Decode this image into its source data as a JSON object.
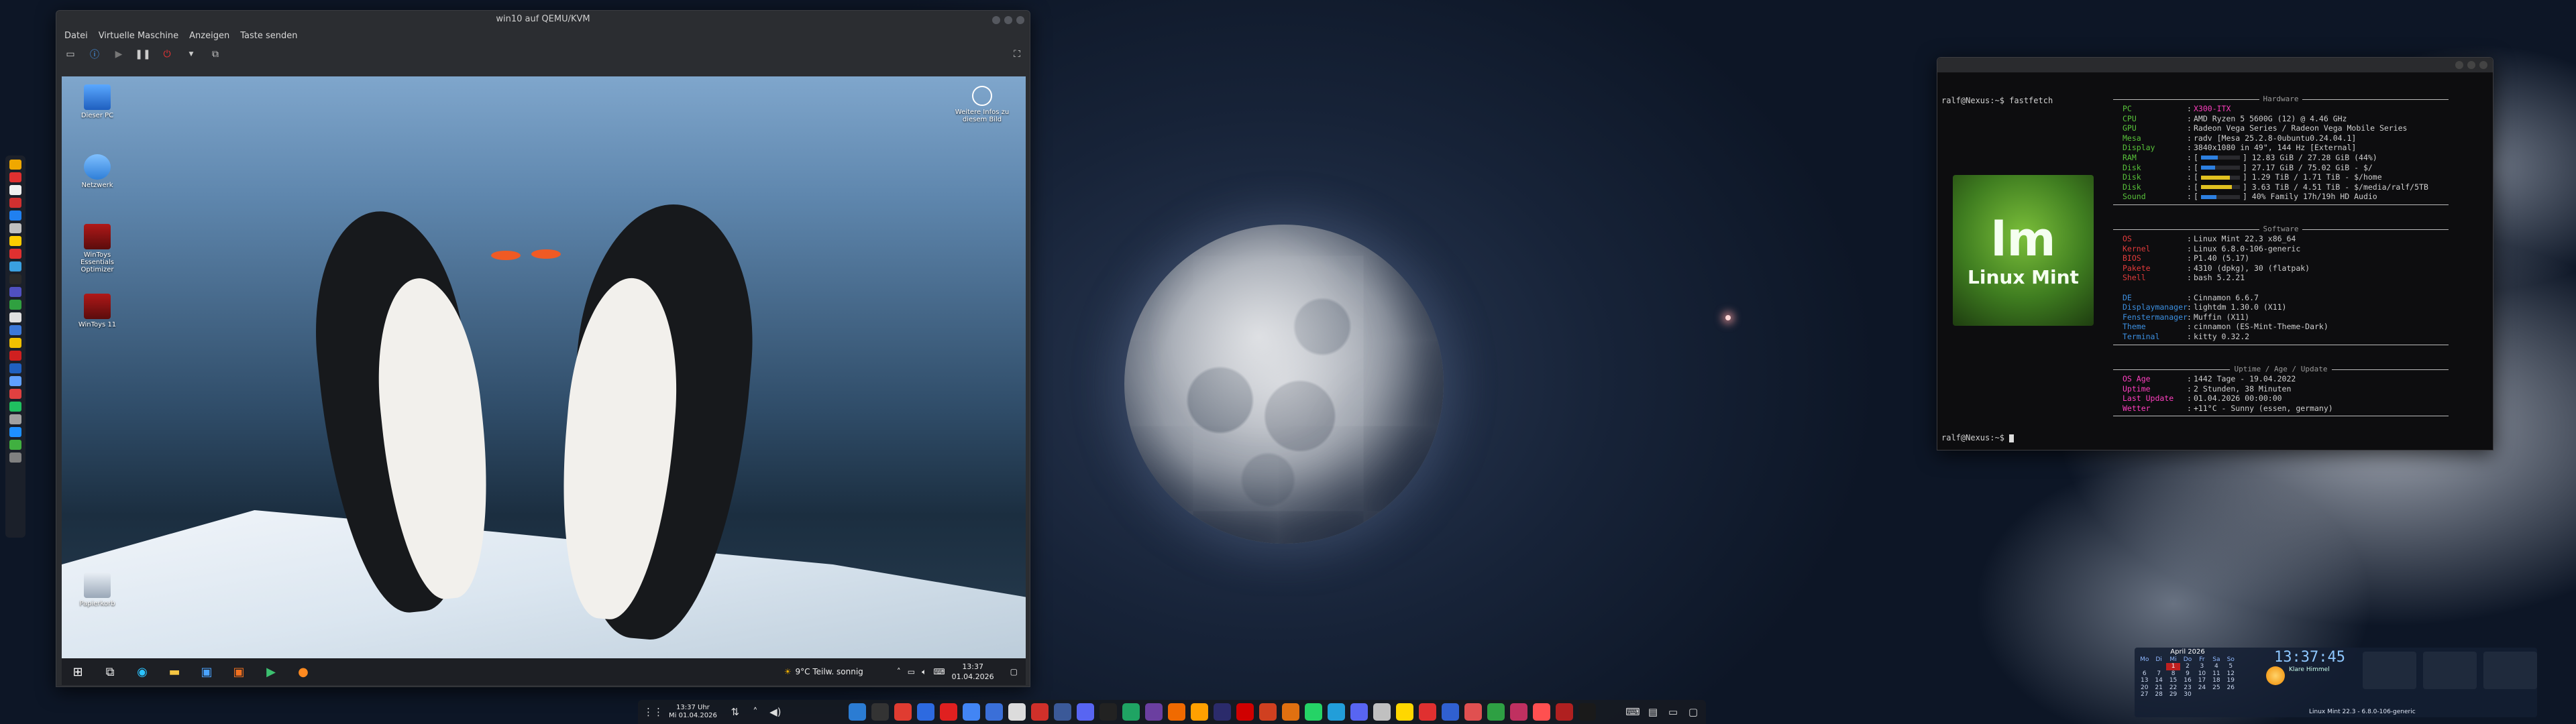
{
  "vm": {
    "title": "win10 auf QEMU/KVM",
    "menu": [
      "Datei",
      "Virtuelle Maschine",
      "Anzeigen",
      "Taste senden"
    ]
  },
  "guest": {
    "icons": [
      {
        "label": "Dieser PC"
      },
      {
        "label": "Netzwerk"
      },
      {
        "label": "WinToys Essentials Optimizer"
      },
      {
        "label": "WinToys 11"
      },
      {
        "label": "Papierkorb"
      }
    ],
    "info_label": "Weitere Infos zu diesem Bild",
    "weather": "9°C  Teilw. sonnig",
    "clock_time": "13:37",
    "clock_date": "01.04.2026"
  },
  "terminal": {
    "prompt": "ralf@Nexus:~$ fastfetch",
    "prompt_end": "ralf@Nexus:~$ ",
    "logo_text": "Linux Mint",
    "sections": [
      {
        "title": "Hardware",
        "rows": [
          {
            "key": "PC",
            "value": "X300-ITX",
            "color": "#58c23a",
            "value_color": "#ff3fbf"
          },
          {
            "key": "CPU",
            "value": "AMD Ryzen 5 5600G (12) @ 4.46 GHz",
            "color": "#58c23a"
          },
          {
            "key": "GPU",
            "value": "Radeon Vega Series / Radeon Vega Mobile Series",
            "color": "#58c23a"
          },
          {
            "key": "Mesa",
            "value": "radv [Mesa 25.2.8-0ubuntu0.24.04.1]",
            "color": "#58c23a"
          },
          {
            "key": "Display",
            "value": "3840x1080 in 49\", 144 Hz [External]",
            "color": "#58c23a"
          },
          {
            "key": "RAM",
            "value": "] 12.83 GiB / 27.28 GiB (44%)",
            "color": "#58c23a",
            "bar": 0.44,
            "bar_color": "#2d7fe0"
          },
          {
            "key": "Disk",
            "value": "] 27.17 GiB / 75.02 GiB - $/",
            "color": "#58c23a",
            "bar": 0.36,
            "bar_color": "#2d7fe0"
          },
          {
            "key": "Disk",
            "value": "] 1.29 TiB / 1.71 TiB - $/home",
            "color": "#58c23a",
            "bar": 0.75,
            "bar_color": "#e0c020"
          },
          {
            "key": "Disk",
            "value": "] 3.63 TiB / 4.51 TiB - $/media/ralf/5TB",
            "color": "#58c23a",
            "bar": 0.8,
            "bar_color": "#e0c020"
          },
          {
            "key": "Sound",
            "value": "] 40% Family 17h/19h HD Audio",
            "color": "#58c23a",
            "bar": 0.4,
            "bar_color": "#2d7fe0"
          }
        ]
      },
      {
        "title": "Software",
        "rows": [
          {
            "key": "OS",
            "value": "Linux Mint 22.3 x86_64",
            "color": "#e23b3b"
          },
          {
            "key": "Kernel",
            "value": "Linux 6.8.0-106-generic",
            "color": "#e23b3b"
          },
          {
            "key": "BIOS",
            "value": "P1.40 (5.17)",
            "color": "#e23b3b"
          },
          {
            "key": "Pakete",
            "value": "4310 (dpkg), 30 (flatpak)",
            "color": "#e23b3b"
          },
          {
            "key": "Shell",
            "value": "bash 5.2.21",
            "color": "#e23b3b"
          },
          {
            "key": "",
            "value": "",
            "color": "#e23b3b"
          },
          {
            "key": "DE",
            "value": "Cinnamon 6.6.7",
            "color": "#3c8fe0"
          },
          {
            "key": "Displaymanager",
            "value": "lightdm 1.30.0 (X11)",
            "color": "#3c8fe0"
          },
          {
            "key": "Fenstermanager",
            "value": "Muffin (X11)",
            "color": "#3c8fe0"
          },
          {
            "key": "Theme",
            "value": "cinnamon (ES-Mint-Theme-Dark)",
            "color": "#3c8fe0"
          },
          {
            "key": "Terminal",
            "value": "kitty 0.32.2",
            "color": "#3c8fe0"
          }
        ]
      },
      {
        "title": "Uptime / Age / Update",
        "rows": [
          {
            "key": "OS Age",
            "value": "1442 Tage - 19.04.2022",
            "color": "#ff3fbf"
          },
          {
            "key": "Uptime",
            "value": "2 Stunden, 38 Minuten",
            "color": "#ff3fbf"
          },
          {
            "key": "Last Update",
            "value": "01.04.2026 00:00:00",
            "color": "#ff3fbf"
          },
          {
            "key": "Wetter",
            "value": "+11°C - Sunny (essen, germany)",
            "color": "#ff3fbf"
          }
        ]
      }
    ]
  },
  "conky": {
    "month": "April 2026",
    "weekdays": [
      "Mo",
      "Di",
      "Mi",
      "Do",
      "Fr",
      "Sa",
      "So"
    ],
    "days": [
      "",
      "",
      "1",
      "2",
      "3",
      "4",
      "5",
      "6",
      "7",
      "8",
      "9",
      "10",
      "11",
      "12",
      "13",
      "14",
      "15",
      "16",
      "17",
      "18",
      "19",
      "20",
      "21",
      "22",
      "23",
      "24",
      "25",
      "26",
      "27",
      "28",
      "29",
      "30",
      "",
      "",
      "",
      ""
    ],
    "time": "13:37:45",
    "date": "Klare Himmel",
    "host": "Linux Mint 22.3 - 6.8.0-106-generic"
  },
  "panel": {
    "clock_time": "13:37 Uhr",
    "clock_date": "Mi 01.04.2026"
  },
  "colors": {
    "dock_icons": [
      "#f0a800",
      "#e03030",
      "#f0f0f0",
      "#d03030",
      "#2080f0",
      "#c0c0c0",
      "#ffcc00",
      "#e03030",
      "#3aa0e0",
      "#2a2a2a",
      "#5050c0",
      "#30a040",
      "#e0e0e0",
      "#3c78d8",
      "#f0c000",
      "#d02020",
      "#2060c0",
      "#60a0ff",
      "#e04040",
      "#20c060",
      "#a0a0a0",
      "#1e90ff",
      "#40b040",
      "#808080"
    ],
    "panel_icons": [
      "#2b7cd3",
      "#333",
      "#e03c31",
      "#2d6ae0",
      "#e02020",
      "#4285f4",
      "#3a6fd8",
      "#dcdcdc",
      "#d0302a",
      "#3b5998",
      "#5865f2",
      "#222",
      "#1fa463",
      "#6b3fa0",
      "#f06a00",
      "#ffa000",
      "#2b2b6b",
      "#d00000",
      "#d04020",
      "#e07010",
      "#25d366",
      "#229ed9",
      "#5865f2",
      "#c0c0c0",
      "#ffd700",
      "#e03030",
      "#3060d0",
      "#e05050",
      "#2ea043",
      "#c03060",
      "#ff5050",
      "#b02020",
      "#1a1a1a"
    ]
  }
}
